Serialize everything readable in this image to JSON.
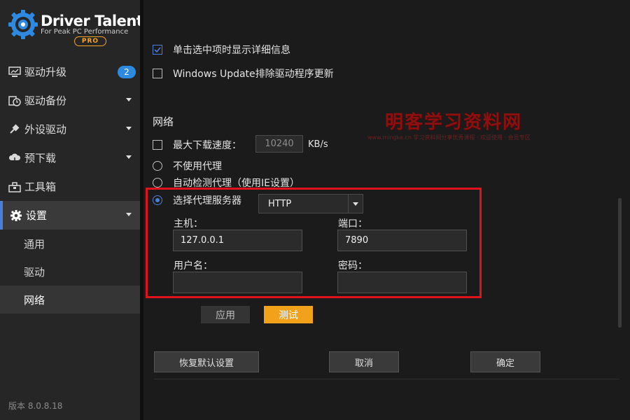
{
  "app": {
    "title": "Driver Talent",
    "subtitle": "For Peak PC Performance",
    "edition": "PRO",
    "version": "版本 8.0.8.18",
    "accent_color": "#2d8ae0",
    "highlight_color": "#e0121b",
    "button_orange": "#f2a11b"
  },
  "sidebar": {
    "items": [
      {
        "label": "驱动升级",
        "icon": "monitor-icon",
        "badge": "2"
      },
      {
        "label": "驱动备份",
        "icon": "backup-clock-icon"
      },
      {
        "label": "外设驱动",
        "icon": "plug-icon"
      },
      {
        "label": "预下载",
        "icon": "cloud-download-icon"
      },
      {
        "label": "工具箱",
        "icon": "toolbox-icon"
      },
      {
        "label": "设置",
        "icon": "gear-icon"
      }
    ],
    "subitems": [
      {
        "label": "通用"
      },
      {
        "label": "驱动"
      },
      {
        "label": "网络"
      }
    ]
  },
  "titlebar": {
    "menu_icon": "menu-icon",
    "minimize_icon": "minimize-icon",
    "close_icon": "close-icon"
  },
  "settings": {
    "show_details_label": "单击选中项时显示详细信息",
    "windows_update_label": "Windows Update排除驱动程序更新",
    "network_title": "网络",
    "max_speed_label": "最大下载速度：",
    "max_speed_value": "10240",
    "speed_unit": "KB/s",
    "no_proxy_label": "不使用代理",
    "auto_proxy_label": "自动检测代理（使用IE设置）",
    "select_proxy_label": "选择代理服务器",
    "proxy_type": "HTTP",
    "host_label": "主机：",
    "host_value": "127.0.0.1",
    "port_label": "端口：",
    "port_value": "7890",
    "username_label": "用户名：",
    "username_value": "",
    "password_label": "密码：",
    "password_value": "",
    "apply_label": "应用",
    "test_label": "测试",
    "restore_label": "恢复默认设置",
    "cancel_label": "取消",
    "confirm_label": "确定"
  },
  "watermark": {
    "text": "明客学习资料网",
    "subtext": "www.mingke.cn    学习资料网分享优秀课程 · 欢迎使用 · 会员专区"
  }
}
